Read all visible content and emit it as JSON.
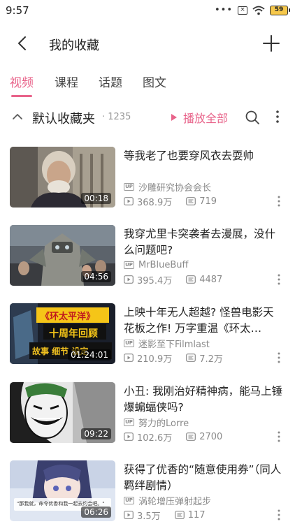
{
  "status_bar": {
    "time": "9:57",
    "signal_box": "×",
    "battery": "59"
  },
  "header": {
    "title": "我的收藏",
    "back_icon": "back-arrow-icon",
    "add_icon": "plus-icon"
  },
  "tabs": [
    {
      "label": "视频",
      "active": true
    },
    {
      "label": "课程",
      "active": false
    },
    {
      "label": "话题",
      "active": false
    },
    {
      "label": "图文",
      "active": false
    }
  ],
  "folder": {
    "name": "默认收藏夹",
    "count": "· 1235",
    "play_all": "播放全部"
  },
  "colors": {
    "accent": "#e8638a",
    "text": "#212121",
    "meta": "#8a8a8a"
  },
  "videos": [
    {
      "title": "等我老了也要穿风衣去耍帅",
      "uploader": "沙雕研究协会会长",
      "views": "368.9万",
      "danmaku": "719",
      "duration": "00:18"
    },
    {
      "title": "我穿尤里卡突袭者去漫展，没什么问题吧?",
      "uploader": "MrBlueBuff",
      "views": "395.4万",
      "danmaku": "4487",
      "duration": "04:56"
    },
    {
      "title": "上映十年无人超越? 怪兽电影天花板之作! 万字重温《环太…",
      "uploader": "迷影至下Filmlast",
      "views": "210.9万",
      "danmaku": "7.2万",
      "duration": "01:24:01",
      "thumb_text": [
        "《环太平洋》",
        "十周年回顾",
        "故事 细节 设定"
      ]
    },
    {
      "title": "小丑: 我刚治好精神病，能马上锤爆蝙蝠侠吗?",
      "uploader": "努力的Lorre",
      "views": "102.6万",
      "danmaku": "2700",
      "duration": "09:22"
    },
    {
      "title": "获得了优香的“随意使用券”（同人羁绊剧情）",
      "uploader": "涡轮增压弹射起步",
      "views": "3.5万",
      "danmaku": "117",
      "duration": "06:26",
      "thumb_text": [
        "\"那我就，命令优香和我一起去约会吧。\""
      ]
    }
  ]
}
